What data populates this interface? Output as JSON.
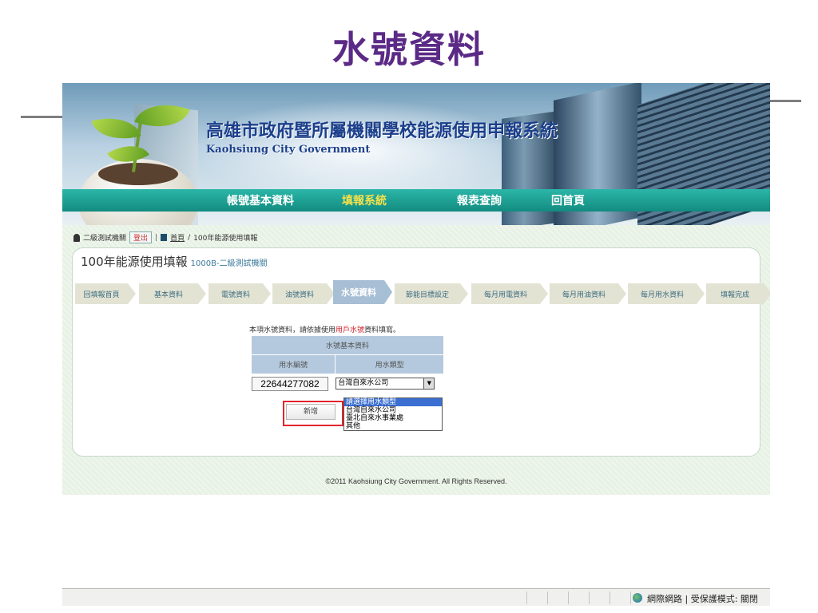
{
  "slide_title": "水號資料",
  "site": {
    "title": "高雄市政府暨所屬機關學校能源使用申報系統",
    "subtitle": "Kaohsiung City Government"
  },
  "nav": [
    {
      "label": "帳號基本資料",
      "active": false
    },
    {
      "label": "填報系統",
      "active": true
    },
    {
      "label": "報表查詢",
      "active": false
    },
    {
      "label": "回首頁",
      "active": false
    }
  ],
  "breadcrumb": {
    "user": "二級測試機關",
    "logout": "登出",
    "home": "首頁",
    "separator": "/",
    "current": "100年能源使用填報"
  },
  "panel": {
    "heading": "100年能源使用填報",
    "org": "1000B-二級測試機關"
  },
  "steps": [
    {
      "label": "回填報首頁",
      "active": false
    },
    {
      "label": "基本資料",
      "active": false
    },
    {
      "label": "電號資料",
      "active": false
    },
    {
      "label": "油號資料",
      "active": false
    },
    {
      "label": "水號資料",
      "active": true
    },
    {
      "label": "節能目標設定",
      "active": false
    },
    {
      "label": "每月用電資料",
      "active": false
    },
    {
      "label": "每月用油資料",
      "active": false
    },
    {
      "label": "每月用水資料",
      "active": false
    },
    {
      "label": "填報完成",
      "active": false
    }
  ],
  "note": {
    "before": "本項水號資料，請依據使用",
    "highlight": "用戶水號",
    "after": "資料填寫。"
  },
  "water_table": {
    "caption": "水號基本資料",
    "col_number": "用水編號",
    "col_type": "用水類型",
    "number_value": "22644277082",
    "type_selected": "台灣自來水公司",
    "options": [
      "請選擇用水類型",
      "台灣自來水公司",
      "臺北自來水事業處",
      "其他"
    ],
    "highlighted_option": "請選擇用水類型"
  },
  "add_button": "新增",
  "footer": "©2011 Kaohsiung City Government. All Rights Reserved.",
  "status": {
    "zone": "網際網路 | 受保護模式: 關閉"
  }
}
